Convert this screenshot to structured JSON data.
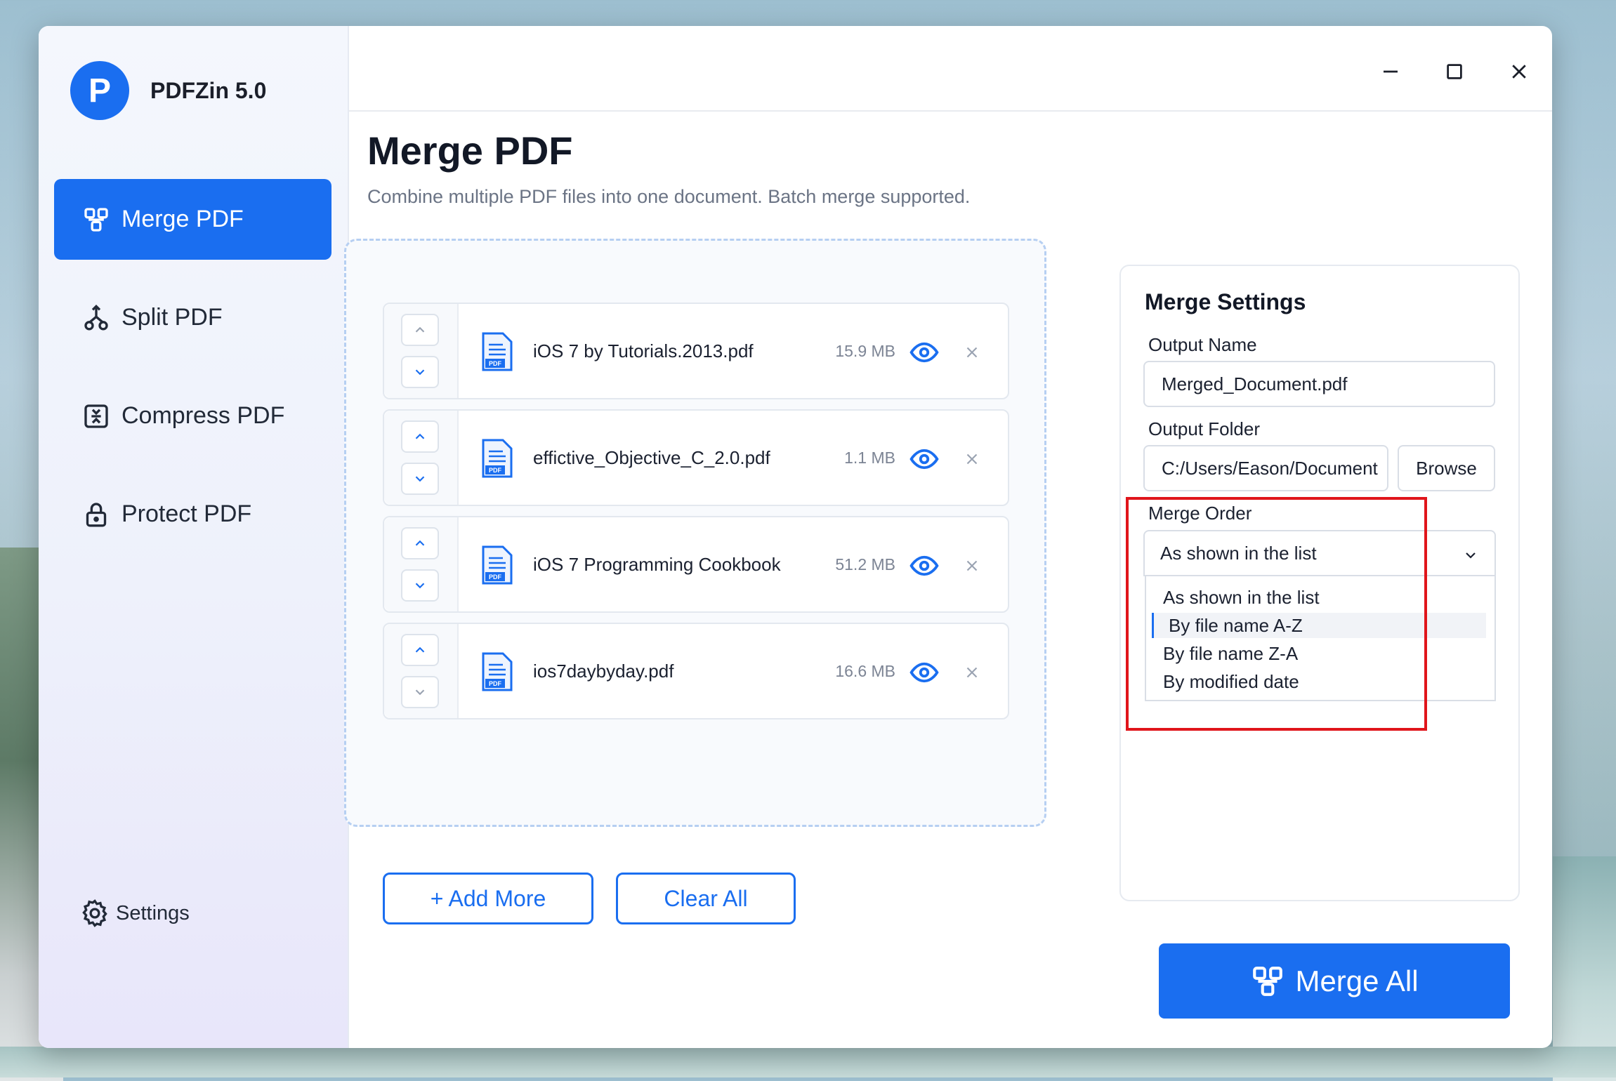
{
  "app": {
    "logo_letter": "P",
    "name": "PDFZin 5.0"
  },
  "sidebar": {
    "items": [
      {
        "label": "Merge PDF",
        "icon": "merge-icon",
        "active": true
      },
      {
        "label": "Split PDF",
        "icon": "split-icon",
        "active": false
      },
      {
        "label": "Compress PDF",
        "icon": "compress-icon",
        "active": false
      },
      {
        "label": "Protect PDF",
        "icon": "lock-icon",
        "active": false
      }
    ],
    "settings_label": "Settings"
  },
  "window_controls": [
    "minimize-icon",
    "maximize-icon",
    "close-icon"
  ],
  "main": {
    "title": "Merge PDF",
    "subtitle": "Combine multiple PDF files into one document. Batch merge supported.",
    "files": [
      {
        "name": "iOS 7 by Tutorials.2013.pdf",
        "size": "15.9 MB"
      },
      {
        "name": "effictive_Objective_C_2.0.pdf",
        "size": "1.1 MB"
      },
      {
        "name": "iOS 7 Programming Cookbook",
        "size": "51.2 MB"
      },
      {
        "name": "ios7daybyday.pdf",
        "size": "16.6 MB"
      }
    ],
    "add_more_label": "+ Add More",
    "clear_all_label": "Clear All"
  },
  "settings": {
    "title": "Merge Settings",
    "output_name_label": "Output Name",
    "output_name_value": "Merged_Document.pdf",
    "output_folder_label": "Output Folder",
    "output_folder_value": "C:/Users/Eason/Document",
    "browse_label": "Browse",
    "merge_order_label": "Merge Order",
    "merge_order_selected": "As shown in the list",
    "merge_order_options": [
      "As shown in the list",
      "By file name A-Z",
      "By file name Z-A",
      "By modified date"
    ],
    "hovered_option": "By file name A-Z"
  },
  "merge_all_label": "Merge All",
  "colors": {
    "accent": "#1a6ef0",
    "highlight": "#e0151b"
  }
}
